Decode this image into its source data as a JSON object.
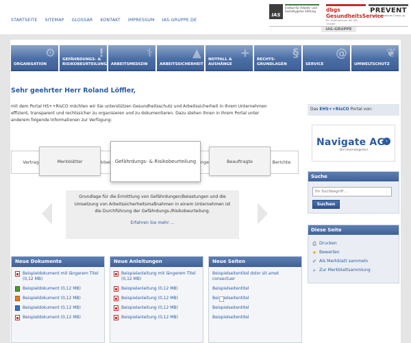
{
  "header": {
    "links": [
      "STARTSEITE",
      "SITEMAP",
      "GLOSSAR",
      "KONTAKT",
      "IMPRESSUM",
      "IAS-GRUPPE.DE"
    ],
    "logos": {
      "ias_mark": "IAS",
      "ias_caption": "Institut für Arbeits- und Sozialhygiene Stiftung",
      "dbgs_title": "dbgs GesundheitsService",
      "dbgs_caption": "Ein Unternehmen der IAS-Gruppe",
      "prevent_title": "PREVENT",
      "prevent_caption": "Der Gesundheits Check-up"
    },
    "group_label": "IAS-GRUPPE"
  },
  "nav": [
    {
      "label": "ORGANISATION",
      "icon": "gear-icon",
      "glyph": "⚙"
    },
    {
      "label": "GEFÄHRDUNGS- & RISIKOBEURTEILUNG",
      "icon": "warning-icon",
      "glyph": "!"
    },
    {
      "label": "ARBEITSMEDIZIN",
      "icon": "doctor-icon",
      "glyph": "⚕"
    },
    {
      "label": "ARBEITSSICHERHEIT",
      "icon": "helmet-icon",
      "glyph": "▲"
    },
    {
      "label": "NOTFALL & AUSHÄNGE",
      "icon": "cross-icon",
      "glyph": "+"
    },
    {
      "label": "RECHTS- GRUNDLAGEN",
      "icon": "paragraph-icon",
      "glyph": "§"
    },
    {
      "label": "SERVICE",
      "icon": "at-icon",
      "glyph": "@"
    },
    {
      "label": "UMWELTSCHUTZ",
      "icon": "leaf-icon",
      "glyph": "❦"
    }
  ],
  "greeting": "Sehr geehrter Herr Roland Löffler,",
  "intro": "mit dem Portal HS++RisCO möchten wir Sie unterstützen Gesundheitsschutz und Arbeitssicherheit in Ihrem Unternehmen effizient, transparent und rechtssicher zu organisieren und zu dokumentieren. Dazu stehen Ihnen in Ihrem Portal unter anderem folgende Informationen zur Verfügung:",
  "carousel": {
    "tabs": [
      "Vertrag",
      "Merkblätter",
      "Arbeitsmittel",
      "Gefährdungs- & Risikobeurteilung",
      "Gefährdungen",
      "Beauftragte",
      "Berichte"
    ],
    "description": "Grundlage für die Ermittlung von Gefährdungen/Belastungen und die Umsetzung von Arbeitssicherheitsmaßnahmen in einem Unternehmen ist die Durchführung der Gefährdungs-/Risikobeurteilung.",
    "more_link": "Erfahren Sie mehr ..."
  },
  "lists": {
    "dokumente": {
      "title": "Neue Dokumente",
      "items": [
        {
          "label": "Beispieldokument mit längerem Titel (0,12 MB)",
          "type": "pdf"
        },
        {
          "label": "Beispieldokument (0,12 MB)",
          "type": "xls"
        },
        {
          "label": "Beispieldokument (0,12 MB)",
          "type": "ppt"
        },
        {
          "label": "Beispieldokument (0,12 MB)",
          "type": "doc"
        },
        {
          "label": "Beispieldokument (0,12 MB)",
          "type": "pdf"
        }
      ]
    },
    "anleitungen": {
      "title": "Neue Anleitungen",
      "items": [
        {
          "label": "Beispielanleitung mit längerem Titel (0,12 MB)",
          "type": "pdf"
        },
        {
          "label": "Beispielanleitung (0,12 MB)",
          "type": "pdf"
        },
        {
          "label": "Beispielanleitung (0,12 MB)",
          "type": "pdf"
        },
        {
          "label": "Beispielanleitung (0,12 MB)",
          "type": "pdf"
        },
        {
          "label": "Beispielanleitung (0,12 MB)",
          "type": "pdf"
        }
      ]
    },
    "seiten": {
      "title": "Neue Seiten",
      "items": [
        {
          "label": "Beispielseitentitel dolor sit amet consectuer",
          "type": "page"
        },
        {
          "label": "Beispielseitentitel",
          "type": "page"
        },
        {
          "label": "Beispielseitentitel",
          "type": "page"
        },
        {
          "label": "Beispielseitentitel",
          "type": "page"
        },
        {
          "label": "Beispielseitentitel",
          "type": "page"
        }
      ]
    }
  },
  "sidebar": {
    "portal_prefix": "Das",
    "portal_name": "EHS++RisCO",
    "portal_suffix": "Portal von:",
    "sponsor_name": "Navigate AG",
    "sponsor_tagline": "Die Internetagentur",
    "search": {
      "title": "Suche",
      "placeholder": "Ihr Suchbegriff ...",
      "button": "Suchen"
    },
    "this_page": {
      "title": "Diese Seite",
      "links": [
        {
          "label": "Drucken",
          "icon": "printer-icon",
          "glyph": "⎙",
          "color": "#555555"
        },
        {
          "label": "Bewerten",
          "icon": "star-icon",
          "glyph": "★",
          "color": "#e8a317"
        },
        {
          "label": "Als Merkblatt sammeln",
          "icon": "pin-icon",
          "glyph": "✐",
          "color": "#777777"
        },
        {
          "label": "Zur Merkblattsammlung",
          "icon": "folder-search-icon",
          "glyph": "⌕",
          "color": "#2b5aa0"
        }
      ]
    }
  },
  "colors": {
    "brand_blue": "#2b5aa0",
    "nav_blue": "#4b6ea5",
    "accent_red": "#c62828"
  }
}
